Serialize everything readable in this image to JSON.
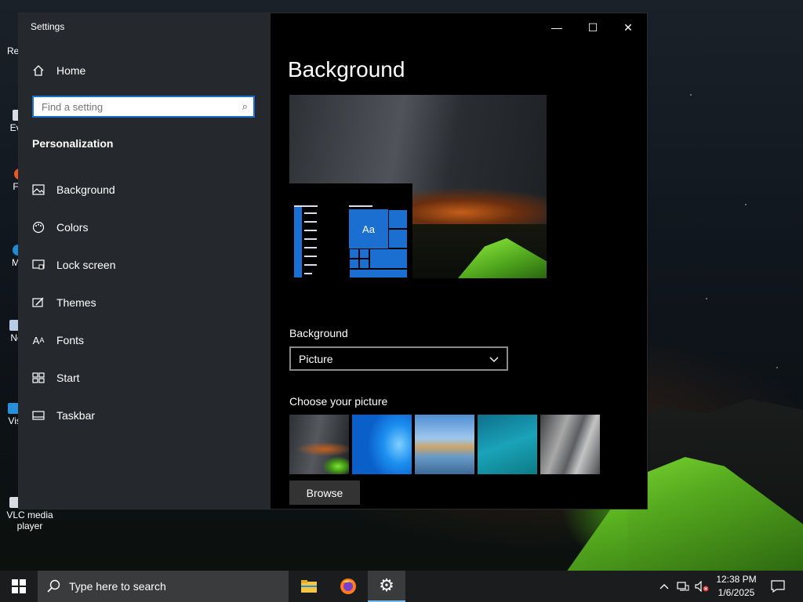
{
  "desktop": {
    "icons": [
      {
        "label": "Rec",
        "name": "recycle-bin"
      },
      {
        "label": "Eve",
        "name": "everything"
      },
      {
        "label": "F",
        "name": "firefox"
      },
      {
        "label": "M",
        "name": "edge"
      },
      {
        "label": "No",
        "name": "notepad"
      },
      {
        "label": "Visu",
        "name": "visual-studio-code"
      }
    ],
    "vlc": {
      "line1": "VLC media",
      "line2": "player"
    }
  },
  "window": {
    "title": "Settings",
    "controls": {
      "minimize": "—",
      "maximize": "☐",
      "close": "✕"
    }
  },
  "sidebar": {
    "home": "Home",
    "search_placeholder": "Find a setting",
    "section": "Personalization",
    "items": [
      {
        "label": "Background",
        "icon": "picture-icon"
      },
      {
        "label": "Colors",
        "icon": "palette-icon"
      },
      {
        "label": "Lock screen",
        "icon": "lock-screen-icon"
      },
      {
        "label": "Themes",
        "icon": "themes-icon"
      },
      {
        "label": "Fonts",
        "icon": "fonts-icon"
      },
      {
        "label": "Start",
        "icon": "start-icon"
      },
      {
        "label": "Taskbar",
        "icon": "taskbar-icon"
      }
    ]
  },
  "main": {
    "title": "Background",
    "preview_tile_text": "Aa",
    "background_label": "Background",
    "background_value": "Picture",
    "choose_label": "Choose your picture",
    "browse": "Browse"
  },
  "taskbar": {
    "search_text": "Type here to search",
    "clock_time": "12:38 PM",
    "clock_date": "1/6/2025"
  },
  "colors": {
    "accent": "#1a6fd0",
    "taskbar": "#1b1c1e",
    "sidebar": "#282c32"
  }
}
